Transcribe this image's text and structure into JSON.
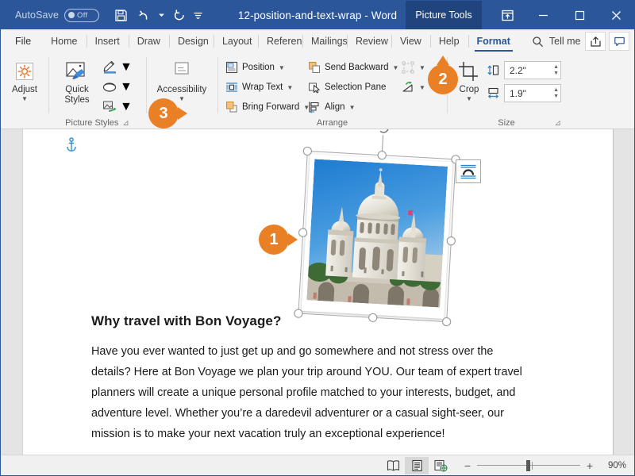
{
  "titlebar": {
    "autosave_label": "AutoSave",
    "autosave_state": "Off",
    "document_title": "12-position-and-text-wrap - Word",
    "contextual_tab": "Picture Tools",
    "qat": [
      {
        "name": "save-icon",
        "label": "Save"
      },
      {
        "name": "undo-icon",
        "label": "Undo"
      },
      {
        "name": "redo-icon",
        "label": "Redo"
      },
      {
        "name": "customize-qat-icon",
        "label": "Customize Quick Access Toolbar"
      }
    ],
    "window_buttons": [
      {
        "name": "ribbon-display-options-button",
        "label": "Ribbon Display Options"
      },
      {
        "name": "minimize-button",
        "label": "Minimize"
      },
      {
        "name": "maximize-button",
        "label": "Maximize"
      },
      {
        "name": "close-button",
        "label": "Close"
      }
    ]
  },
  "tabs": [
    {
      "label": "File",
      "active": false
    },
    {
      "label": "Home",
      "active": false
    },
    {
      "label": "Insert",
      "active": false
    },
    {
      "label": "Draw",
      "active": false
    },
    {
      "label": "Design",
      "active": false
    },
    {
      "label": "Layout",
      "active": false
    },
    {
      "label": "References",
      "active": false
    },
    {
      "label": "Mailings",
      "active": false
    },
    {
      "label": "Review",
      "active": false
    },
    {
      "label": "View",
      "active": false
    },
    {
      "label": "Help",
      "active": false
    },
    {
      "label": "Format",
      "active": true
    }
  ],
  "tellme": {
    "label": "Tell me",
    "icon": "search-icon"
  },
  "tab_right_buttons": [
    {
      "name": "share-button",
      "label": "Share"
    },
    {
      "name": "comments-button",
      "label": "Comments"
    }
  ],
  "ribbon": {
    "groups": [
      {
        "name": "adjust",
        "label": "Adjust",
        "has_dialog_launcher": false,
        "buttons": [
          {
            "name": "adjust-button",
            "label": "Adjust",
            "icon": "brightness-icon",
            "dropdown": true
          }
        ]
      },
      {
        "name": "picture-styles",
        "label": "Picture Styles",
        "has_dialog_launcher": true,
        "buttons": [
          {
            "name": "quick-styles-button",
            "label": "Quick Styles",
            "icon": "picture-style-icon",
            "dropdown": true
          },
          {
            "name": "picture-border-button",
            "label": "Picture Border",
            "icon": "pen-border-icon",
            "dropdown": true
          },
          {
            "name": "picture-effects-button",
            "label": "Picture Effects",
            "icon": "effects-icon",
            "dropdown": true
          },
          {
            "name": "picture-layout-button",
            "label": "Picture Layout",
            "icon": "picture-layout-icon",
            "dropdown": true
          }
        ]
      },
      {
        "name": "accessibility",
        "label": "",
        "has_dialog_launcher": false,
        "buttons": [
          {
            "name": "alt-text-button",
            "label": "Accessibility",
            "icon": "alt-text-icon",
            "dropdown": true
          }
        ]
      },
      {
        "name": "arrange",
        "label": "Arrange",
        "has_dialog_launcher": false,
        "buttons": [
          {
            "name": "position-button",
            "label": "Position",
            "icon": "position-icon",
            "dropdown": true
          },
          {
            "name": "wrap-text-button",
            "label": "Wrap Text",
            "icon": "wrap-text-icon",
            "dropdown": true
          },
          {
            "name": "bring-forward-button",
            "label": "Bring Forward",
            "icon": "bring-forward-icon",
            "dropdown": true
          },
          {
            "name": "send-backward-button",
            "label": "Send Backward",
            "icon": "send-backward-icon",
            "dropdown": true
          },
          {
            "name": "selection-pane-button",
            "label": "Selection Pane",
            "icon": "selection-pane-icon",
            "dropdown": false
          },
          {
            "name": "align-button",
            "label": "Align",
            "icon": "align-icon",
            "dropdown": true
          },
          {
            "name": "group-objects-button",
            "label": "Group",
            "icon": "group-icon",
            "dropdown": true,
            "disabled": true
          },
          {
            "name": "rotate-objects-button",
            "label": "Rotate",
            "icon": "rotate-icon",
            "dropdown": true
          }
        ]
      },
      {
        "name": "size",
        "label": "Size",
        "has_dialog_launcher": true,
        "buttons": [
          {
            "name": "crop-button",
            "label": "Crop",
            "icon": "crop-icon",
            "dropdown": true
          }
        ],
        "fields": [
          {
            "name": "shape-height-field",
            "icon": "height-icon",
            "value": "2.2\"",
            "label": "Shape Height"
          },
          {
            "name": "shape-width-field",
            "icon": "width-icon",
            "value": "1.9\"",
            "label": "Shape Width"
          }
        ]
      }
    ]
  },
  "document": {
    "anchor_icon": "anchor-icon",
    "heading": "Why travel with Bon Voyage?",
    "body": "Have you ever wanted to just get up and go somewhere and not stress over the details?  Here at Bon Voyage we plan your trip around YOU. Our team of expert travel planners will create a unique personal profile matched to your interests, budget, and adventure level. Whether you’re a daredevil adventurer or a casual sight-seer, our mission is to make your next vacation truly an exceptional experience!",
    "picture": {
      "name": "sacre-coeur-picture",
      "alt": "Sacré-Cœur Basilica photo",
      "selected": true,
      "rotation_handle": "rotate-handle-icon",
      "handles": 8
    },
    "layout_options_button": {
      "name": "layout-options-button",
      "label": "Layout Options",
      "icon": "layout-options-icon"
    }
  },
  "callouts": [
    {
      "number": "1",
      "direction": "right",
      "target": "picture-side-handle"
    },
    {
      "number": "2",
      "direction": "up",
      "target": "size-group"
    },
    {
      "number": "3",
      "direction": "right",
      "target": "position-button"
    }
  ],
  "statusbar": {
    "view_buttons": [
      {
        "name": "read-mode-button",
        "label": "Read Mode",
        "active": false
      },
      {
        "name": "print-layout-button",
        "label": "Print Layout",
        "active": true
      },
      {
        "name": "web-layout-button",
        "label": "Web Layout",
        "active": false
      }
    ],
    "zoom_out_label": "−",
    "zoom_in_label": "+",
    "zoom_level": "90%"
  },
  "colors": {
    "brand_blue": "#2b579a",
    "contextual_tab_blue": "#20457e",
    "callout_orange": "#ea8025",
    "accent_orange": "#ed7d31",
    "ribbon_bg": "#f3f3f3"
  }
}
